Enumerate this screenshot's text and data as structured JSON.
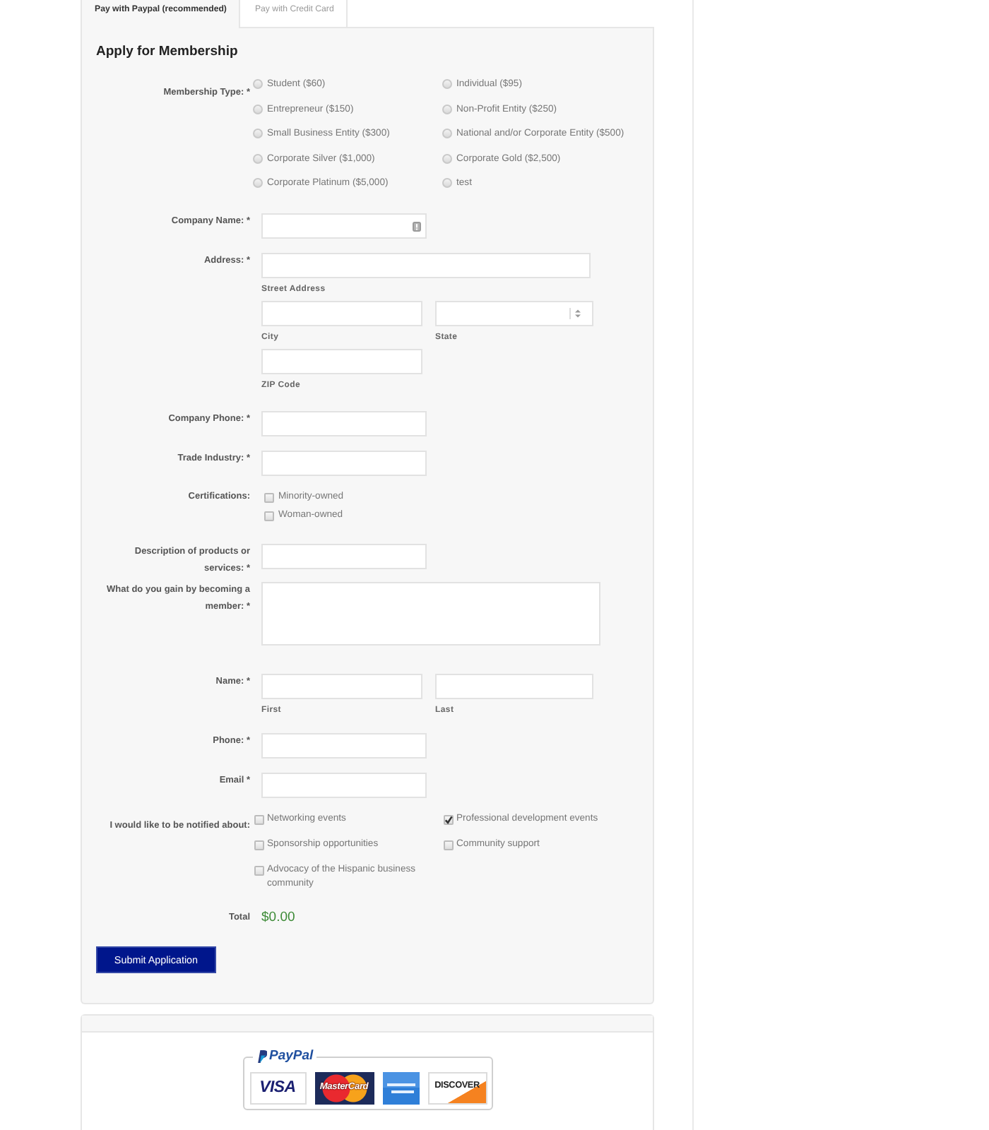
{
  "tabs": [
    {
      "label": "Pay with Paypal (recommended)",
      "selected": true
    },
    {
      "label": "Pay with Credit Card",
      "selected": false
    }
  ],
  "form": {
    "title": "Apply for Membership",
    "rows": [
      {
        "kind": "radio-grid",
        "label": "Membership Type: *",
        "options": [
          {
            "label": "Student ($60)",
            "selected": false
          },
          {
            "label": "Individual ($95)",
            "selected": false
          },
          {
            "label": "Entrepreneur ($150)",
            "selected": false
          },
          {
            "label": "Non-Profit Entity ($250)",
            "selected": false
          },
          {
            "label": "Small Business Entity ($300)",
            "selected": false
          },
          {
            "label": "National and/or Corporate Entity ($500)",
            "selected": false
          },
          {
            "label": "Corporate Silver ($1,000)",
            "selected": false
          },
          {
            "label": "Corporate Gold ($2,500)",
            "selected": false
          },
          {
            "label": "Corporate Platinum ($5,000)",
            "selected": false
          },
          {
            "label": "test",
            "selected": false
          }
        ]
      },
      {
        "kind": "text",
        "label": "Company Name: *",
        "autofill_icon": true
      },
      {
        "kind": "address",
        "label": "Address: *",
        "street_caption": "Street Address",
        "city_caption": "City",
        "state_caption": "State",
        "zip_caption": "ZIP Code"
      },
      {
        "kind": "text",
        "label": "Company Phone: *"
      },
      {
        "kind": "text",
        "label": "Trade Industry: *"
      },
      {
        "kind": "checkbox-list",
        "label": "Certifications:",
        "options": [
          {
            "label": "Minority-owned",
            "checked": false
          },
          {
            "label": "Woman-owned",
            "checked": false
          }
        ]
      },
      {
        "kind": "text",
        "label": "Description of products or services: *"
      },
      {
        "kind": "textarea",
        "label": "What do you gain by becoming a member: *"
      },
      {
        "kind": "name",
        "label": "Name: *",
        "first_caption": "First",
        "last_caption": "Last"
      },
      {
        "kind": "text",
        "label": "Phone: *"
      },
      {
        "kind": "text",
        "label": "Email *"
      },
      {
        "kind": "checkbox-grid",
        "label": "I would like to be notified about:",
        "options": [
          {
            "label": "Networking events",
            "checked": false
          },
          {
            "label": "Professional development events",
            "checked": true
          },
          {
            "label": "Sponsorship opportunities",
            "checked": false
          },
          {
            "label": "Community support",
            "checked": false
          },
          {
            "label": "Advocacy of the Hispanic business community",
            "checked": false
          }
        ]
      },
      {
        "kind": "total",
        "label": "Total",
        "value": "$0.00"
      }
    ],
    "submit": {
      "label": "Submit Application"
    }
  },
  "payment": {
    "title": "PayPal",
    "cards": [
      {
        "kind": "visa",
        "label": "VISA"
      },
      {
        "kind": "mastercard",
        "label": "MasterCard"
      },
      {
        "kind": "amex"
      },
      {
        "kind": "discover",
        "label": "DISCOVER"
      }
    ]
  }
}
